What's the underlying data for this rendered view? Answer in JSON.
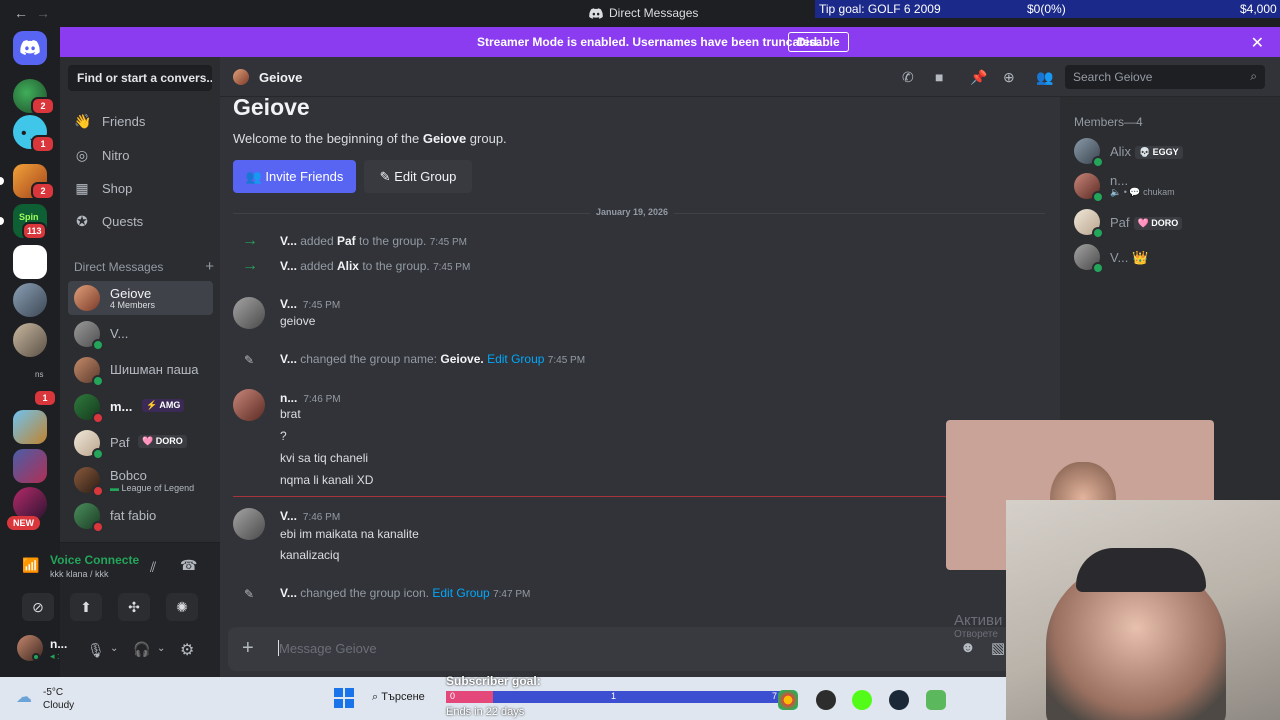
{
  "window": {
    "title": "Direct Messages",
    "back": "←",
    "forward": "→"
  },
  "tip_goal": {
    "label": "Tip goal: GOLF 6 2009",
    "current": "$0(0%)",
    "target": "$4,000"
  },
  "banner": {
    "text": "Streamer Mode is enabled. Usernames have been truncated.",
    "button": "Disable",
    "close": "✕"
  },
  "servers": {
    "badges": [
      "2",
      "1",
      "2",
      "113",
      "1"
    ],
    "partial_label": "ns",
    "new_badge": "NEW"
  },
  "sidebar": {
    "find": "Find or start a convers...",
    "nav": [
      {
        "label": "Friends",
        "icon": "friends-icon"
      },
      {
        "label": "Nitro",
        "icon": "nitro-icon"
      },
      {
        "label": "Shop",
        "icon": "shop-icon"
      },
      {
        "label": "Quests",
        "icon": "quests-icon"
      }
    ],
    "dm_header": "Direct Messages",
    "dm_add": "+",
    "dms": [
      {
        "name": "Geiove",
        "sub": "4 Members"
      },
      {
        "name": "V..."
      },
      {
        "name": "Шишман паша"
      },
      {
        "name": "m...",
        "tag": "⚡ AMG"
      },
      {
        "name": "Paf",
        "tag": "🩷 DORO"
      },
      {
        "name": "Bobco",
        "sub": "League of Legend"
      },
      {
        "name": "fat fabio"
      }
    ]
  },
  "voice": {
    "status": "Voice Connecte",
    "channel": "kkk klana / kkk",
    "user": "n...",
    "user_sub": "◂ :"
  },
  "chat": {
    "header_name": "Geiove",
    "search_placeholder": "Search Geiove",
    "intro_title": "Geiove",
    "intro_text_pre": "Welcome to the beginning of the ",
    "intro_text_name": "Geiove",
    "intro_text_post": " group.",
    "invite_button": "Invite Friends",
    "edit_button": "Edit Group",
    "date_divider": "January 19, 2026",
    "sys1": {
      "actor": "V...",
      "verb": "added",
      "target": "Paf",
      "rest": "to the group.",
      "time": "7:45 PM"
    },
    "sys2": {
      "actor": "V...",
      "verb": "added",
      "target": "Alix",
      "rest": "to the group.",
      "time": "7:45 PM"
    },
    "msg1": {
      "author": "V...",
      "time": "7:45 PM",
      "lines": [
        "geiove"
      ]
    },
    "sys3": {
      "actor": "V...",
      "verb": "changed the group name:",
      "target": "Geiove.",
      "link": "Edit Group",
      "time": "7:45 PM"
    },
    "msg2": {
      "author": "n...",
      "time": "7:46 PM",
      "lines": [
        "brat",
        "?",
        "kvi sa tiq chaneli",
        "nqma li kanali XD"
      ]
    },
    "msg3": {
      "author": "V...",
      "time": "7:46 PM",
      "lines": [
        "ebi im maikata na kanalite",
        "kanalizaciq"
      ]
    },
    "sys4": {
      "actor": "V...",
      "verb": "changed the group icon.",
      "link": "Edit Group",
      "time": "7:47 PM"
    },
    "composer_placeholder": "Message Geiove"
  },
  "members": {
    "header": "Members—4",
    "list": [
      {
        "name": "Alix",
        "tag": "💀 EGGY"
      },
      {
        "name": "n...",
        "sub": "🔈 • 💬 chukam"
      },
      {
        "name": "Paf",
        "tag": "🩷 DORO"
      },
      {
        "name": "V...",
        "crown": "👑"
      }
    ]
  },
  "taskbar": {
    "temp": "-5°C",
    "weather": "Cloudy",
    "search": "Търсене",
    "subgoal_title": "Subscriber goal:",
    "subgoal_start": "0",
    "subgoal_mid": "1",
    "subgoal_end": "7",
    "subgoal_progress": 0.14,
    "subgoal_sub": "Ends in 22 days"
  },
  "watermark": {
    "line1": "Активи",
    "line2": "Отворете"
  }
}
